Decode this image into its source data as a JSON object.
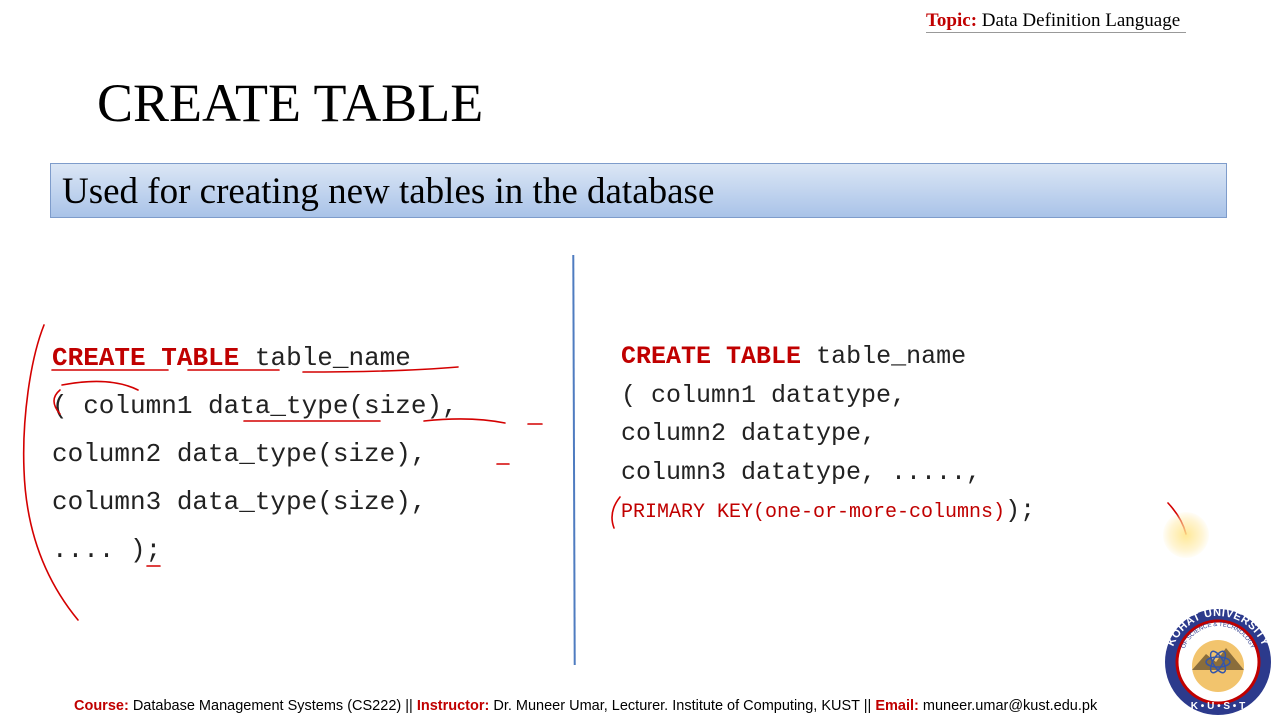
{
  "header": {
    "topic_label": "Topic:",
    "topic_value": "Data Definition Language"
  },
  "title": "CREATE TABLE",
  "banner": "Used for creating new tables in the database",
  "left_code": {
    "kw1": "CREATE",
    "kw2": "TABLE",
    "table_name": "table_name",
    "line2": "( column1 data_type(size),",
    "line3": "column2 data_type(size),",
    "line4": "column3 data_type(size),",
    "line5": ".... );"
  },
  "right_code": {
    "kw1": "CREATE",
    "kw2": "TABLE",
    "table_name": "table_name",
    "line2": "( column1 datatype,",
    "line3": "column2 datatype,",
    "line4": "column3 datatype, .....,",
    "line5_pk": "PRIMARY KEY(one-or-more-columns)",
    "line5_end": ");"
  },
  "logo": {
    "text": "KOHAT UNIVERSITY OF SCIENCE & TECHNOLOGY",
    "letters": "K U S T"
  },
  "footer": {
    "course_label": "Course:",
    "course_value": "Database Management Systems (CS222) ||",
    "instructor_label": "Instructor:",
    "instructor_value": "Dr. Muneer Umar, Lecturer. Institute of Computing, KUST ||",
    "email_label": "Email:",
    "email_value": "muneer.umar@kust.edu.pk"
  },
  "colors": {
    "accent_red": "#c00000",
    "banner_blue": "#a9c3e8",
    "divider_blue": "#4f7cc0"
  }
}
